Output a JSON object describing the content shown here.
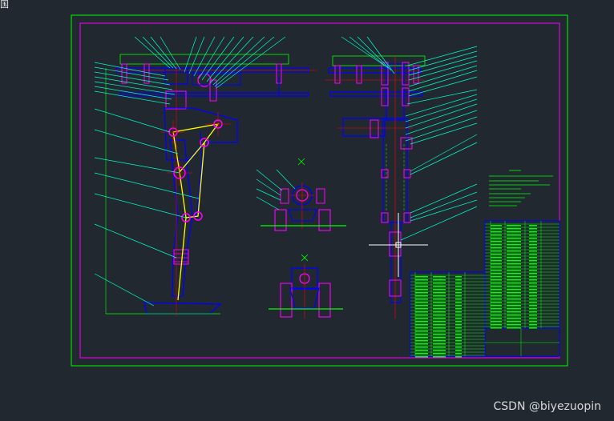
{
  "corner_glyph": "国",
  "watermark": "CSDN @biyezuopin",
  "colors": {
    "background": "#212830",
    "outer_frame": "#00ff00",
    "inner_frame": "#ff00ff",
    "leader": "#00ffcc",
    "part": "#0000ff",
    "bolt": "#ff00ff",
    "center": "#ff0000",
    "link": "#ffff00",
    "table_text": "#00ff00",
    "crosshair": "#ffffff"
  },
  "cursor_icon": "crosshair-cursor-icon"
}
